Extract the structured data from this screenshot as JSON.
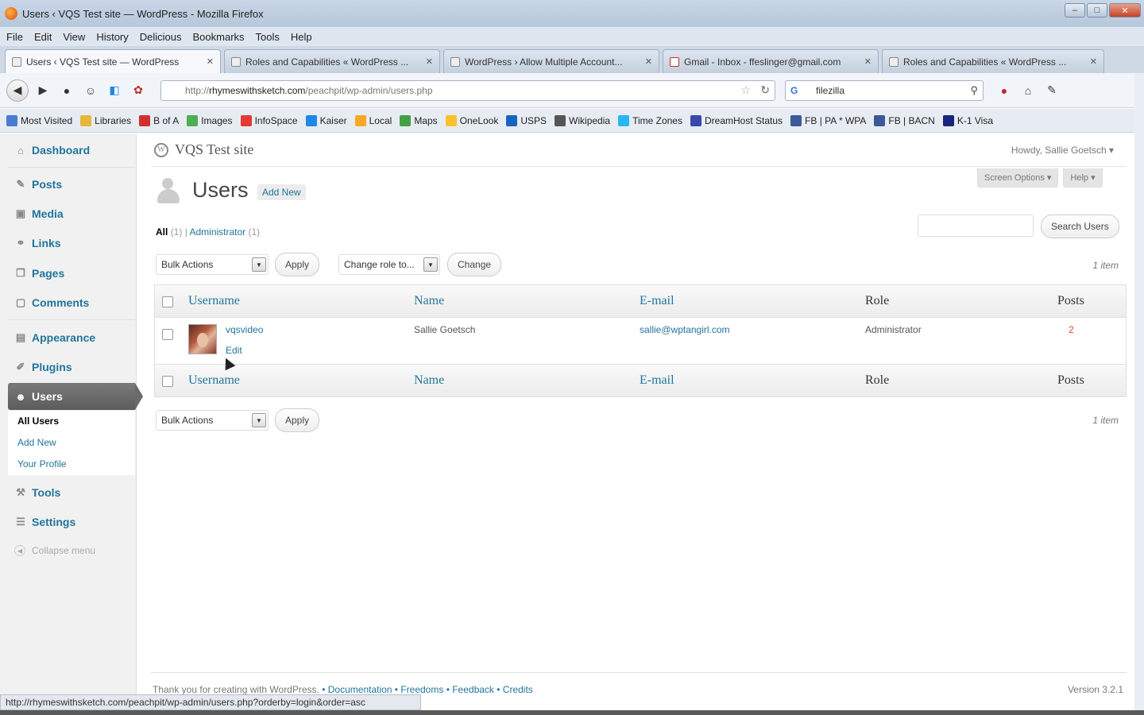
{
  "window": {
    "title": "Users ‹ VQS Test site — WordPress - Mozilla Firefox"
  },
  "menubar": [
    "File",
    "Edit",
    "View",
    "History",
    "Delicious",
    "Bookmarks",
    "Tools",
    "Help"
  ],
  "tabs": [
    {
      "label": "Users ‹ VQS Test site — WordPress",
      "active": true
    },
    {
      "label": "Roles and Capabilities « WordPress ...",
      "active": false
    },
    {
      "label": "WordPress › Allow Multiple Account...",
      "active": false
    },
    {
      "label": "Gmail - Inbox - ffeslinger@gmail.com",
      "active": false
    },
    {
      "label": "Roles and Capabilities « WordPress ...",
      "active": false
    }
  ],
  "url": {
    "prefix": "http://",
    "host": "rhymeswithsketch.com",
    "path": "/peachpit/wp-admin/users.php"
  },
  "search_engine_text": "filezilla",
  "bookmarks": [
    {
      "label": "Most Visited",
      "color": "#4a7bd0"
    },
    {
      "label": "Libraries",
      "color": "#e5b73b"
    },
    {
      "label": "B of A",
      "color": "#d32f2f"
    },
    {
      "label": "Images",
      "color": "#4caf50"
    },
    {
      "label": "InfoSpace",
      "color": "#e53935"
    },
    {
      "label": "Kaiser",
      "color": "#1e88e5"
    },
    {
      "label": "Local",
      "color": "#f9a825"
    },
    {
      "label": "Maps",
      "color": "#43a047"
    },
    {
      "label": "OneLook",
      "color": "#fbc02d"
    },
    {
      "label": "USPS",
      "color": "#1565c0"
    },
    {
      "label": "Wikipedia",
      "color": "#555555"
    },
    {
      "label": "Time Zones",
      "color": "#29b6f6"
    },
    {
      "label": "DreamHost Status",
      "color": "#3949ab"
    },
    {
      "label": "FB | PA * WPA",
      "color": "#3b5998"
    },
    {
      "label": "FB | BACN",
      "color": "#3b5998"
    },
    {
      "label": "K-1 Visa",
      "color": "#1a237e"
    }
  ],
  "site": {
    "title": "VQS Test site",
    "howdy": "Howdy, Sallie Goetsch ▾"
  },
  "screen_options": {
    "screen": "Screen Options ▾",
    "help": "Help ▾"
  },
  "sidebar": {
    "items": [
      {
        "label": "Dashboard",
        "icon": "dashboard-icon",
        "glyph": "⌂"
      },
      {
        "label": "Posts",
        "icon": "pin-icon",
        "glyph": "✎"
      },
      {
        "label": "Media",
        "icon": "media-icon",
        "glyph": "▣"
      },
      {
        "label": "Links",
        "icon": "links-icon",
        "glyph": "⚭"
      },
      {
        "label": "Pages",
        "icon": "pages-icon",
        "glyph": "❐"
      },
      {
        "label": "Comments",
        "icon": "comments-icon",
        "glyph": "▢"
      },
      {
        "label": "Appearance",
        "icon": "appearance-icon",
        "glyph": "▤"
      },
      {
        "label": "Plugins",
        "icon": "plugins-icon",
        "glyph": "✐"
      },
      {
        "label": "Users",
        "icon": "users-icon",
        "glyph": "☻"
      },
      {
        "label": "Tools",
        "icon": "tools-icon",
        "glyph": "⚒"
      },
      {
        "label": "Settings",
        "icon": "settings-icon",
        "glyph": "☰"
      }
    ],
    "users_sub": [
      "All Users",
      "Add New",
      "Your Profile"
    ],
    "collapse": "Collapse menu"
  },
  "page": {
    "title": "Users",
    "add_new": "Add New",
    "filter_all": "All",
    "filter_all_count": "(1)",
    "filter_admin": "Administrator",
    "filter_admin_count": "(1)",
    "search_button": "Search Users",
    "search_value": "",
    "bulk_actions": "Bulk Actions",
    "apply": "Apply",
    "change_role": "Change role to...",
    "change": "Change",
    "items_count": "1 item"
  },
  "table": {
    "columns": [
      "Username",
      "Name",
      "E-mail",
      "Role",
      "Posts"
    ],
    "rows": [
      {
        "username": "vqsvideo",
        "name": "Sallie Goetsch",
        "email": "sallie@wptangirl.com",
        "role": "Administrator",
        "posts": "2",
        "edit": "Edit"
      }
    ]
  },
  "footer": {
    "thanks": "Thank you for creating with WordPress.",
    "links": "• Documentation • Freedoms • Feedback • Credits",
    "version": "Version 3.2.1"
  },
  "statusbar": "http://rhymeswithsketch.com/peachpit/wp-admin/users.php?orderby=login&order=asc"
}
